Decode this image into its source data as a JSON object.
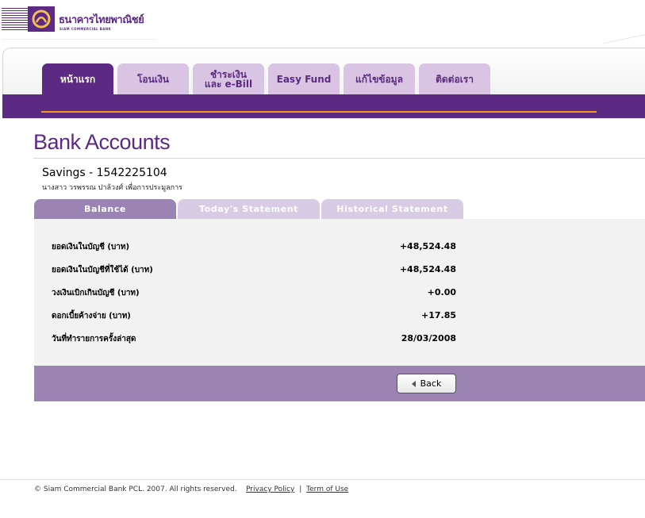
{
  "logo": {
    "thai_name": "ธนาคารไทยพาณิชย์",
    "english_name": "SIAM COMMERCIAL BANK"
  },
  "nav": {
    "tabs": [
      {
        "label": "หน้าแรก",
        "active": true
      },
      {
        "label": "โอนเงิน",
        "active": false
      },
      {
        "label_line1": "ชำระเงิน",
        "label_line2": "และ e-Bill",
        "active": false
      },
      {
        "label": "Easy Fund",
        "active": false
      },
      {
        "label": "แก้ไขข้อมูล",
        "active": false
      },
      {
        "label": "ติดต่อเรา",
        "active": false
      }
    ]
  },
  "page": {
    "title": "Bank Accounts",
    "account_name": "Savings - 1542225104",
    "account_holder": "นางสาว วรพรรณ ปาล้วงศ์ เพื่อการประมูลการ"
  },
  "subtabs": [
    {
      "label": "Balance",
      "active": true
    },
    {
      "label": "Today's Statement",
      "active": false
    },
    {
      "label": "Historical Statement",
      "active": false
    }
  ],
  "balance": {
    "rows": [
      {
        "label": "ยอดเงินในบัญชี (บาท)",
        "value": "+48,524.48"
      },
      {
        "label": "ยอดเงินในบัญชีที่ใช้ได้ (บาท)",
        "value": "+48,524.48"
      },
      {
        "label": "วงเงินเบิกเกินบัญชี (บาท)",
        "value": "+0.00"
      },
      {
        "label": "ดอกเบี้ยค้างจ่าย (บาท)",
        "value": "+17.85"
      },
      {
        "label": "วันที่ทำรายการครั้งล่าสุด",
        "value": "28/03/2008"
      }
    ],
    "back_label": "Back"
  },
  "footer": {
    "copyright": "© Siam Commercial Bank PCL. 2007. All rights reserved.",
    "privacy": "Privacy Policy",
    "separator": "|",
    "terms": "Term of Use"
  },
  "colors": {
    "brand_purple": "#5c2a82",
    "tab_inactive": "#d9c4e4",
    "accent_orange": "#f39a1f",
    "subtab_active": "#9b84b3",
    "subtab_inactive": "#d7cce4",
    "panel_bg": "#f2f2f2"
  },
  "icons": {
    "logo": "scb-emblem-icon",
    "back": "triangle-left-icon"
  }
}
